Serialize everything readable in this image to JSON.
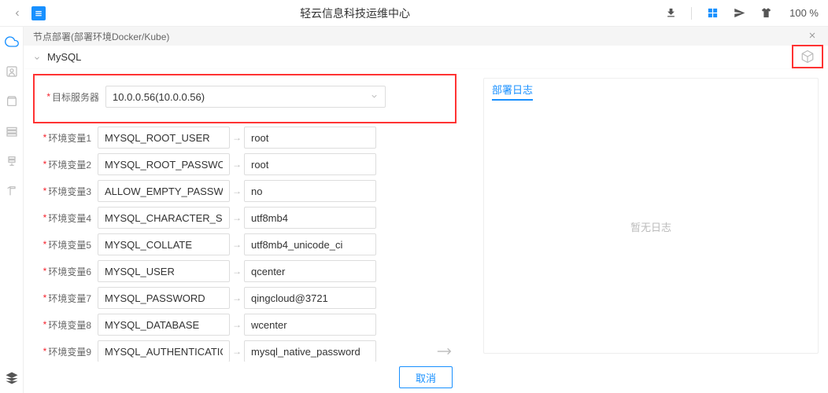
{
  "header": {
    "title": "轻云信息科技运维中心",
    "zoom": "100 %"
  },
  "breadcrumb": {
    "text": "节点部署(部署环境Docker/Kube)"
  },
  "section": {
    "title": "MySQL"
  },
  "form": {
    "target_server_label": "目标服务器",
    "target_server_value": "10.0.0.56(10.0.0.56)",
    "env_label_prefix": "环境变量",
    "envs": [
      {
        "idx": "1",
        "key": "MYSQL_ROOT_USER",
        "val": "root"
      },
      {
        "idx": "2",
        "key": "MYSQL_ROOT_PASSWORD",
        "val": "root"
      },
      {
        "idx": "3",
        "key": "ALLOW_EMPTY_PASSWORD",
        "val": "no"
      },
      {
        "idx": "4",
        "key": "MYSQL_CHARACTER_SET",
        "val": "utf8mb4"
      },
      {
        "idx": "5",
        "key": "MYSQL_COLLATE",
        "val": "utf8mb4_unicode_ci"
      },
      {
        "idx": "6",
        "key": "MYSQL_USER",
        "val": "qcenter"
      },
      {
        "idx": "7",
        "key": "MYSQL_PASSWORD",
        "val": "qingcloud@3721"
      },
      {
        "idx": "8",
        "key": "MYSQL_DATABASE",
        "val": "wcenter"
      },
      {
        "idx": "9",
        "key": "MYSQL_AUTHENTICATION_PLUG",
        "val": "mysql_native_password"
      }
    ]
  },
  "log": {
    "tab_label": "部署日志",
    "empty_text": "暂无日志"
  },
  "buttons": {
    "cancel": "取消"
  }
}
